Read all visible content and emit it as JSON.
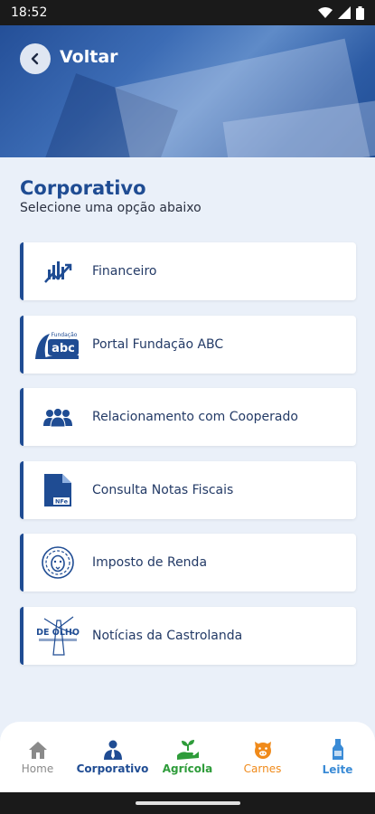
{
  "status_bar": {
    "time": "18:52"
  },
  "header": {
    "back_label": "Voltar"
  },
  "page": {
    "title": "Corporativo",
    "subtitle": "Selecione uma opção abaixo"
  },
  "menu": {
    "items": [
      {
        "label": "Financeiro",
        "icon": "finance-chart-icon"
      },
      {
        "label": "Portal Fundação ABC",
        "icon": "fundacao-abc-logo",
        "logo_text": "Fundação abc"
      },
      {
        "label": "Relacionamento com Cooperado",
        "icon": "people-group-icon"
      },
      {
        "label": "Consulta Notas Fiscais",
        "icon": "nfe-document-icon",
        "logo_text": "NFe"
      },
      {
        "label": "Imposto de Renda",
        "icon": "lion-icon"
      },
      {
        "label": "Notícias da Castrolanda",
        "icon": "de-olho-logo",
        "logo_text": "DE OLHO"
      }
    ]
  },
  "bottom_nav": {
    "items": [
      {
        "label": "Home",
        "color": "#8a8a8a"
      },
      {
        "label": "Corporativo",
        "color": "#1f4c93"
      },
      {
        "label": "Agrícola",
        "color": "#2e9c3a"
      },
      {
        "label": "Carnes",
        "color": "#f08a1a"
      },
      {
        "label": "Leite",
        "color": "#3a8bd6"
      }
    ]
  },
  "colors": {
    "primary": "#1f4c93",
    "background": "#eaf0f9"
  }
}
